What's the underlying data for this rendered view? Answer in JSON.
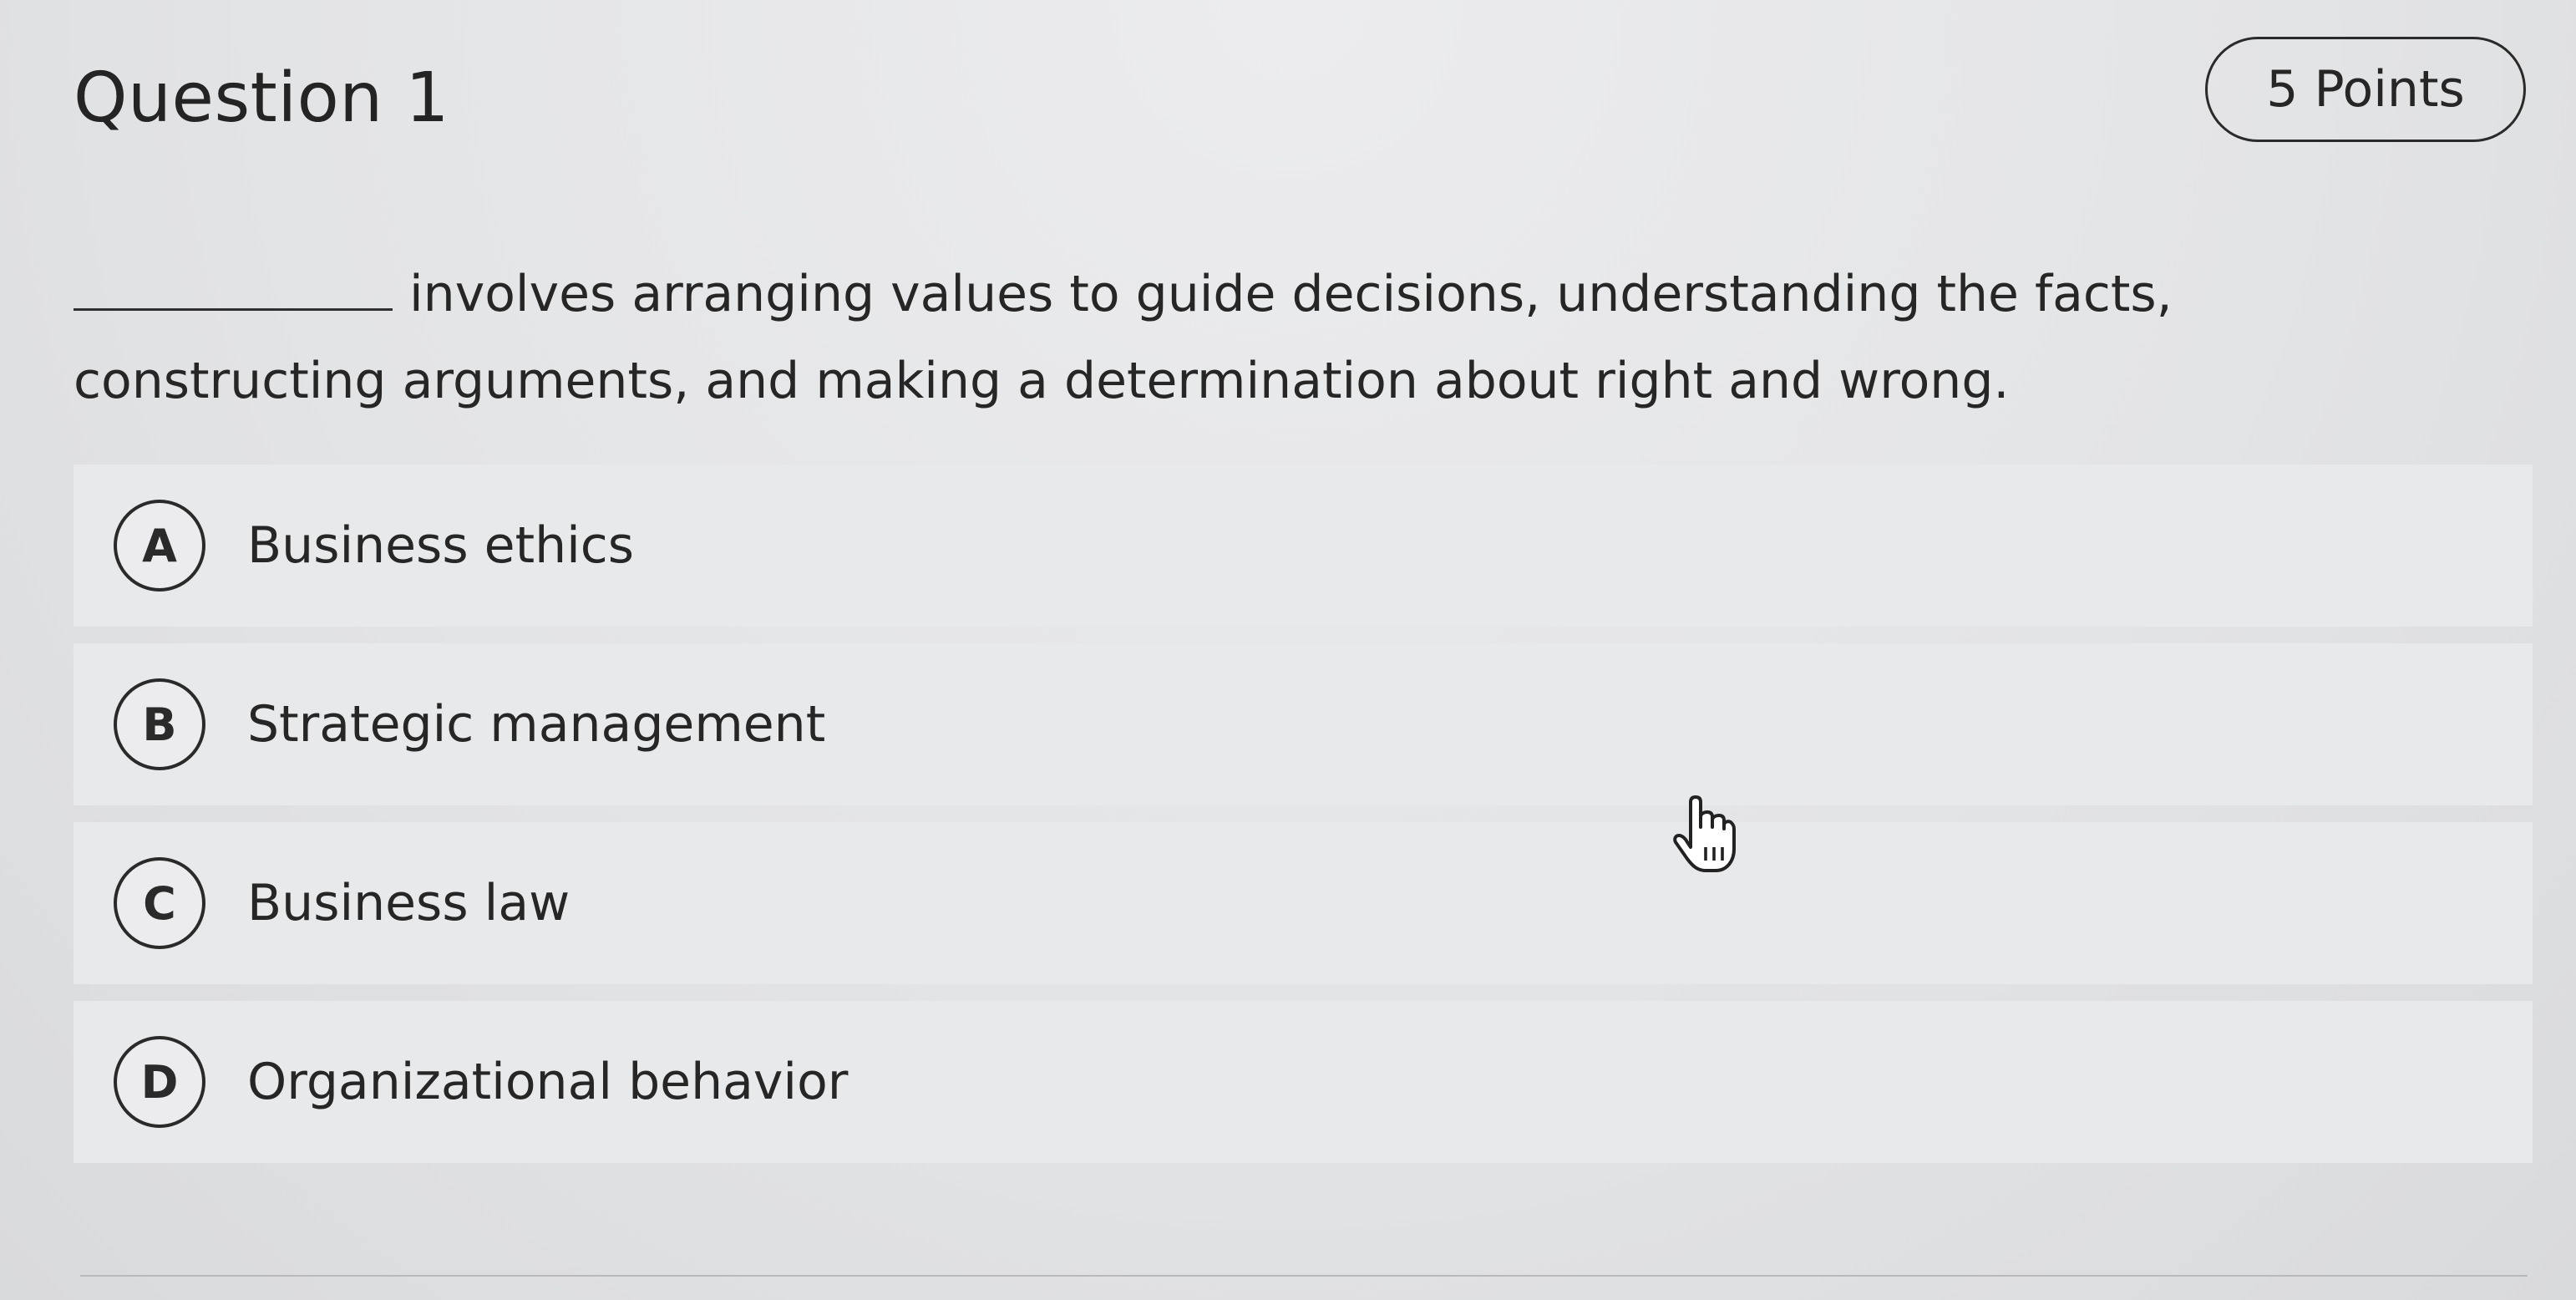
{
  "question": {
    "title": "Question 1",
    "points": "5 Points",
    "text": "involves arranging values to guide decisions, understanding the facts, constructing arguments, and making a determination about right and wrong."
  },
  "options": [
    {
      "letter": "A",
      "label": "Business ethics"
    },
    {
      "letter": "B",
      "label": "Strategic management"
    },
    {
      "letter": "C",
      "label": "Business law"
    },
    {
      "letter": "D",
      "label": "Organizational behavior"
    }
  ],
  "icons": {
    "cursor": "hand-pointer-icon"
  }
}
